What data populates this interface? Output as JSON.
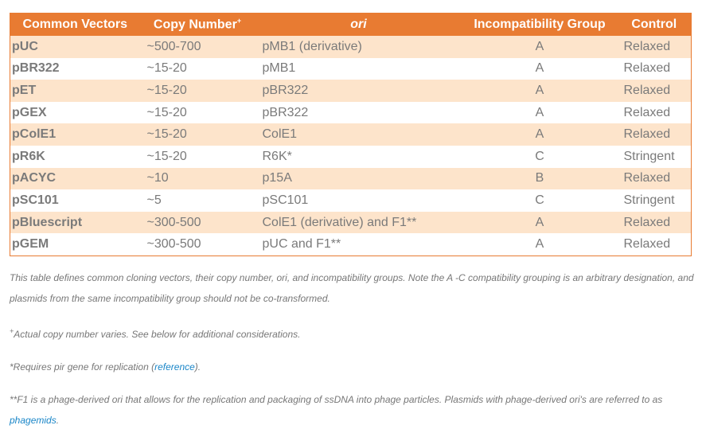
{
  "table": {
    "headers": [
      "Common Vectors",
      "Copy Number",
      "ori",
      "Incompatibility Group",
      "Control"
    ],
    "copy_header_superscript": "+",
    "rows": [
      {
        "vector": "pUC",
        "copy": "~500-700",
        "ori": "pMB1 (derivative)",
        "group": "A",
        "control": "Relaxed"
      },
      {
        "vector": "pBR322",
        "copy": "~15-20",
        "ori": "pMB1",
        "group": "A",
        "control": "Relaxed"
      },
      {
        "vector": "pET",
        "copy": "~15-20",
        "ori": "pBR322",
        "group": "A",
        "control": "Relaxed"
      },
      {
        "vector": "pGEX",
        "copy": "~15-20",
        "ori": "pBR322",
        "group": "A",
        "control": "Relaxed"
      },
      {
        "vector": "pColE1",
        "copy": "~15-20",
        "ori": "ColE1",
        "group": "A",
        "control": "Relaxed"
      },
      {
        "vector": "pR6K",
        "copy": "~15-20",
        "ori": "R6K*",
        "group": "C",
        "control": "Stringent"
      },
      {
        "vector": "pACYC",
        "copy": "~10",
        "ori": "p15A",
        "group": "B",
        "control": "Relaxed"
      },
      {
        "vector": "pSC101",
        "copy": "~5",
        "ori": "pSC101",
        "group": "C",
        "control": "Stringent"
      },
      {
        "vector": "pBluescript",
        "copy": "~300-500",
        "ori": "ColE1 (derivative) and F1**",
        "group": "A",
        "control": "Relaxed"
      },
      {
        "vector": "pGEM",
        "copy": "~300-500",
        "ori": "pUC and F1**",
        "group": "A",
        "control": "Relaxed"
      }
    ]
  },
  "notes": {
    "caption": "This table defines common cloning vectors, their copy number, ori, and incompatibility groups. Note the A -C compatibility grouping is an arbitrary designation, and plasmids from the same incompatibility group should not be co-transformed.",
    "plus_mark": "+",
    "plus_note": "Actual copy number varies. See below for additional considerations.",
    "star_note_pre": "*Requires pir gene for replication (",
    "star_note_link": "reference",
    "star_note_post": ").",
    "dstar_note": "**F1 is a phage-derived ori that allows for the replication and packaging of ssDNA into phage particles. Plasmids with phage-derived ori's are referred to as ",
    "dstar_link": "phagemids",
    "dstar_post": "."
  },
  "colors": {
    "header": "#e87b32",
    "row_alt": "#fde4cb",
    "link": "#1a86c8",
    "text": "#7a7a7a"
  }
}
